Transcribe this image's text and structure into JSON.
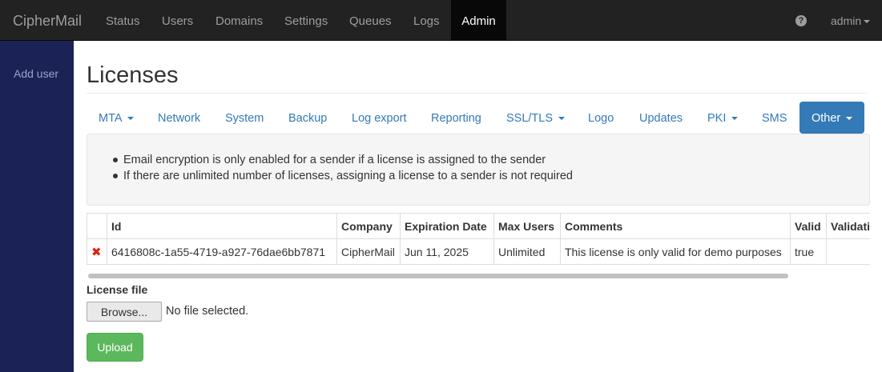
{
  "brand": "CipherMail",
  "nav": {
    "items": [
      "Status",
      "Users",
      "Domains",
      "Settings",
      "Queues",
      "Logs",
      "Admin"
    ],
    "active": "Admin",
    "help_icon": "question-circle-icon",
    "user": "admin"
  },
  "sidebar": {
    "items": [
      {
        "label": "Add user"
      }
    ]
  },
  "page": {
    "title": "Licenses"
  },
  "tabs": [
    {
      "label": "MTA",
      "dropdown": true
    },
    {
      "label": "Network"
    },
    {
      "label": "System"
    },
    {
      "label": "Backup"
    },
    {
      "label": "Log export"
    },
    {
      "label": "Reporting"
    },
    {
      "label": "SSL/TLS",
      "dropdown": true
    },
    {
      "label": "Logo"
    },
    {
      "label": "Updates"
    },
    {
      "label": "PKI",
      "dropdown": true
    },
    {
      "label": "SMS"
    },
    {
      "label": "Other",
      "dropdown": true,
      "active": true
    }
  ],
  "info": {
    "items": [
      "Email encryption is only enabled for a sender if a license is assigned to the sender",
      "If there are unlimited number of licenses, assigning a license to a sender is not required"
    ]
  },
  "table": {
    "columns": [
      "",
      "Id",
      "Company",
      "Expiration Date",
      "Max Users",
      "Comments",
      "Valid",
      "Validation"
    ],
    "rows": [
      {
        "delete_icon": "✖",
        "id": "6416808c-1a55-4719-a927-76dae6bb7871",
        "company": "CipherMail",
        "expiration_date": "Jun 11, 2025",
        "max_users": "Unlimited",
        "comments": "This license is only valid for demo purposes",
        "valid": "true",
        "validation": ""
      }
    ]
  },
  "upload": {
    "label": "License file",
    "browse_label": "Browse...",
    "file_status": "No file selected.",
    "submit_label": "Upload"
  },
  "colors": {
    "navbar": "#222222",
    "sidebar": "#1b2256",
    "primary": "#337ab7",
    "success": "#5cb85c",
    "danger": "#d9230f"
  }
}
